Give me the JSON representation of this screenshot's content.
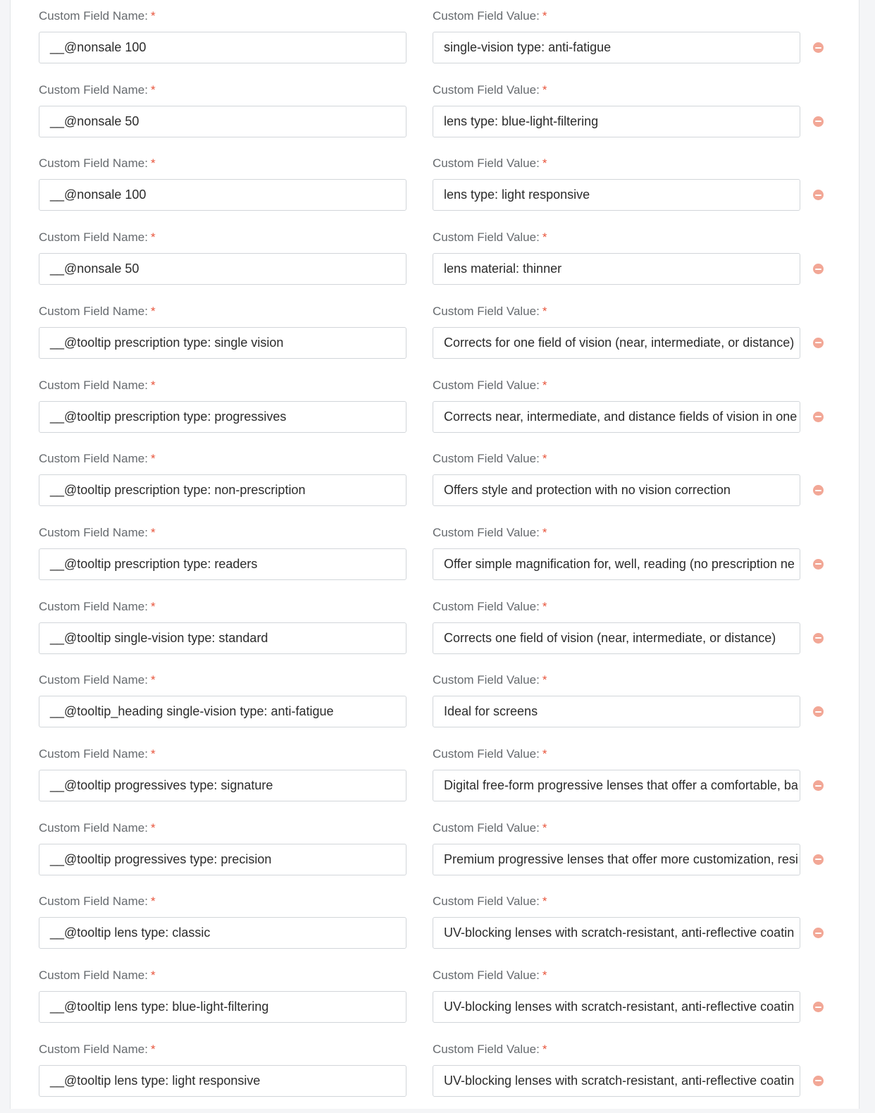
{
  "labels": {
    "name": "Custom Field Name:",
    "value": "Custom Field Value:",
    "required": "*"
  },
  "colors": {
    "required": "#e8553c",
    "remove_button": "#f2a796"
  },
  "fields": [
    {
      "name": "__@nonsale 100",
      "value": "single-vision type: anti-fatigue"
    },
    {
      "name": "__@nonsale 50",
      "value": "lens type: blue-light-filtering"
    },
    {
      "name": "__@nonsale 100",
      "value": "lens type: light responsive"
    },
    {
      "name": "__@nonsale 50",
      "value": "lens material: thinner"
    },
    {
      "name": "__@tooltip prescription type: single vision",
      "value": "Corrects for one field of vision (near, intermediate, or distance)"
    },
    {
      "name": "__@tooltip prescription type: progressives",
      "value": "Corrects near, intermediate, and distance fields of vision in one"
    },
    {
      "name": "__@tooltip prescription type: non-prescription",
      "value": "Offers style and protection with no vision correction"
    },
    {
      "name": "__@tooltip prescription type: readers",
      "value": "Offer simple magnification for, well, reading (no prescription ne"
    },
    {
      "name": "__@tooltip single-vision type: standard",
      "value": "Corrects one field of vision (near, intermediate, or distance)"
    },
    {
      "name": "__@tooltip_heading single-vision type: anti-fatigue",
      "value": "Ideal for screens"
    },
    {
      "name": "__@tooltip progressives type: signature",
      "value": "Digital free-form progressive lenses that offer a comfortable, ba"
    },
    {
      "name": "__@tooltip progressives type: precision",
      "value": "Premium progressive lenses that offer more customization, resi"
    },
    {
      "name": "__@tooltip lens type: classic",
      "value": "UV-blocking lenses with scratch-resistant, anti-reflective coatin"
    },
    {
      "name": "__@tooltip lens type: blue-light-filtering",
      "value": "UV-blocking lenses with scratch-resistant, anti-reflective coatin"
    },
    {
      "name": "__@tooltip lens type: light responsive",
      "value": "UV-blocking lenses with scratch-resistant, anti-reflective coatin"
    }
  ],
  "icons": {
    "remove": "minus-circle-icon"
  }
}
